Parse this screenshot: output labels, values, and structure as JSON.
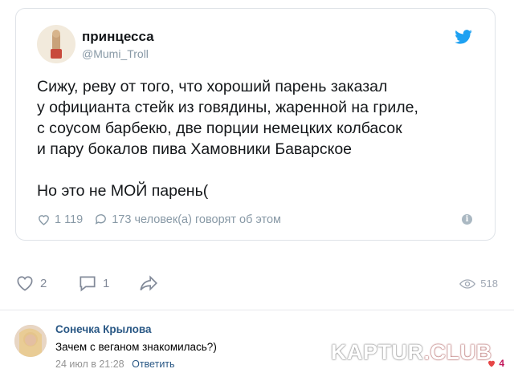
{
  "tweet": {
    "name": "принцесса",
    "handle": "@Mumi_Troll",
    "lines": [
      "Сижу, реву от того, что хороший парень заказал",
      "у официанта стейк из говядины, жаренной на гриле,",
      "с соусом барбекю, две порции немецких колбасок",
      "и пару бокалов пива Хамовники Баварское"
    ],
    "last_line": "Но это не МОЙ парень(",
    "likes": "1 119",
    "talking": "173 человек(а) говорят об этом",
    "info_glyph": "i",
    "icons": {
      "brand": "twitter-bird-icon",
      "like": "heart-outline-icon",
      "talk": "speech-bubble-icon"
    },
    "colors": {
      "twitter_blue": "#1da1f2",
      "muted": "#8899a6"
    }
  },
  "post_actions": {
    "likes": "2",
    "comments": "1",
    "views": "518"
  },
  "comment": {
    "author": "Сонечка Крылова",
    "text": "Зачем с веганом знакомилась?)",
    "date": "24 июл в 21:28",
    "reply_label": "Ответить",
    "likes": "4"
  },
  "watermark": {
    "part1": "KAPTUR",
    "part2": ".CLUB"
  }
}
